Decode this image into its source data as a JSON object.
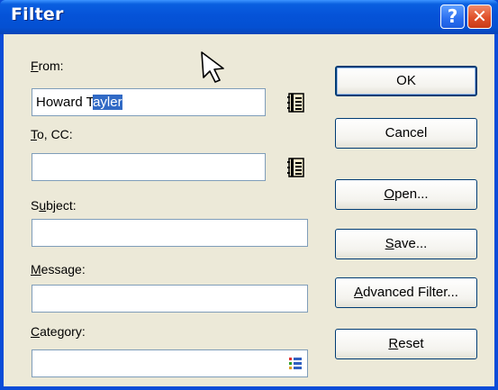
{
  "window": {
    "title": "Filter"
  },
  "titlebar": {
    "help": "?",
    "close": "✕"
  },
  "fields": {
    "from": {
      "label_mnemonic": "F",
      "label_rest": "rom:",
      "value_plain": "Howard T",
      "value_selected": "ayler"
    },
    "to_cc": {
      "label_mnemonic": "T",
      "label_rest": "o, CC:",
      "value": ""
    },
    "subject": {
      "label_pre": "S",
      "label_mnemonic": "u",
      "label_rest": "bject:",
      "value": ""
    },
    "message": {
      "label_mnemonic": "M",
      "label_rest": "essage:",
      "value": ""
    },
    "category": {
      "label_mnemonic": "C",
      "label_rest": "ategory:",
      "value": ""
    }
  },
  "buttons": {
    "ok": "OK",
    "cancel": "Cancel",
    "open": {
      "mnemonic": "O",
      "rest": "pen..."
    },
    "save": {
      "mnemonic": "S",
      "rest": "ave..."
    },
    "advanced": {
      "mnemonic": "A",
      "rest": "dvanced Filter..."
    },
    "reset": {
      "mnemonic": "R",
      "rest": "eset"
    }
  },
  "icons": {
    "address_book": "address-book-icon",
    "category_list": "category-list-icon",
    "pointer": "mouse-pointer-icon"
  },
  "colors": {
    "titlebar": "#0553d8",
    "selection": "#316ac5",
    "dialog_bg": "#ece9d8",
    "close_button": "#e0502a"
  }
}
